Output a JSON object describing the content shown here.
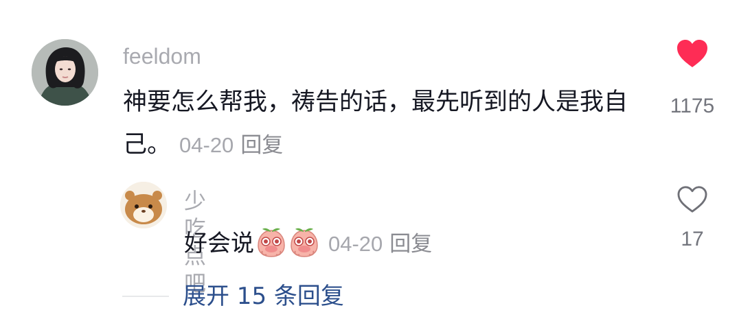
{
  "comment": {
    "username": "feeldom",
    "text": "神要怎么帮我，祷告的话，最先听到的人是我自己。",
    "date": "04-20",
    "reply_label": "回复",
    "like_count": "1175",
    "liked": true,
    "icons": {
      "like": "heart-filled-icon"
    },
    "colors": {
      "like_active": "#fe2c55"
    }
  },
  "reply": {
    "username": "少吃点吧",
    "text": "好会说",
    "emojis": [
      "peach-pleading-emoji",
      "peach-pleading-emoji"
    ],
    "date": "04-20",
    "reply_label": "回复",
    "like_count": "17",
    "liked": false,
    "icons": {
      "like": "heart-outline-icon"
    }
  },
  "expand": {
    "label": "展开 15 条回复",
    "color": "#2c4f8c"
  }
}
